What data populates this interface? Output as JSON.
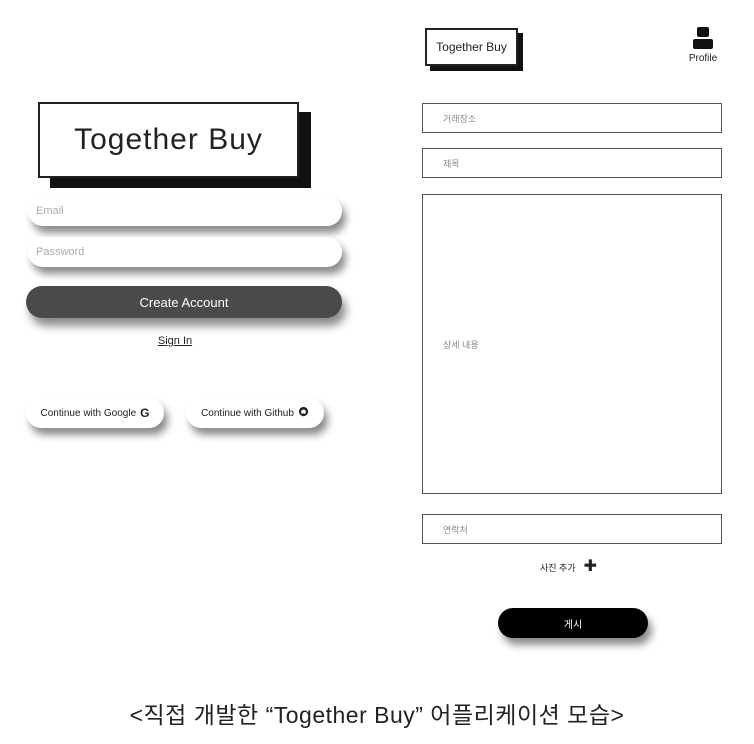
{
  "login": {
    "app_title": "Together Buy",
    "email_placeholder": "Email",
    "password_placeholder": "Password",
    "create_account_label": "Create Account",
    "sign_in_label": "Sign In",
    "google_label": "Continue with Google",
    "google_icon": "google-icon",
    "github_label": "Continue with Github",
    "github_icon": "github-icon"
  },
  "post": {
    "app_title": "Together Buy",
    "profile_label": "Profile",
    "profile_icon": "person-icon",
    "location_placeholder": "거래장소",
    "title_placeholder": "제목",
    "detail_placeholder": "상세 내용",
    "contact_placeholder": "연락처",
    "add_photo_label": "사진 추가",
    "add_photo_icon": "plus-icon",
    "submit_label": "게시"
  },
  "caption": "<직접 개발한 “Together Buy” 어플리케이션 모습>",
  "colors": {
    "dark_button": "#4a4a4a",
    "black_button": "#000000",
    "border": "#222222"
  }
}
